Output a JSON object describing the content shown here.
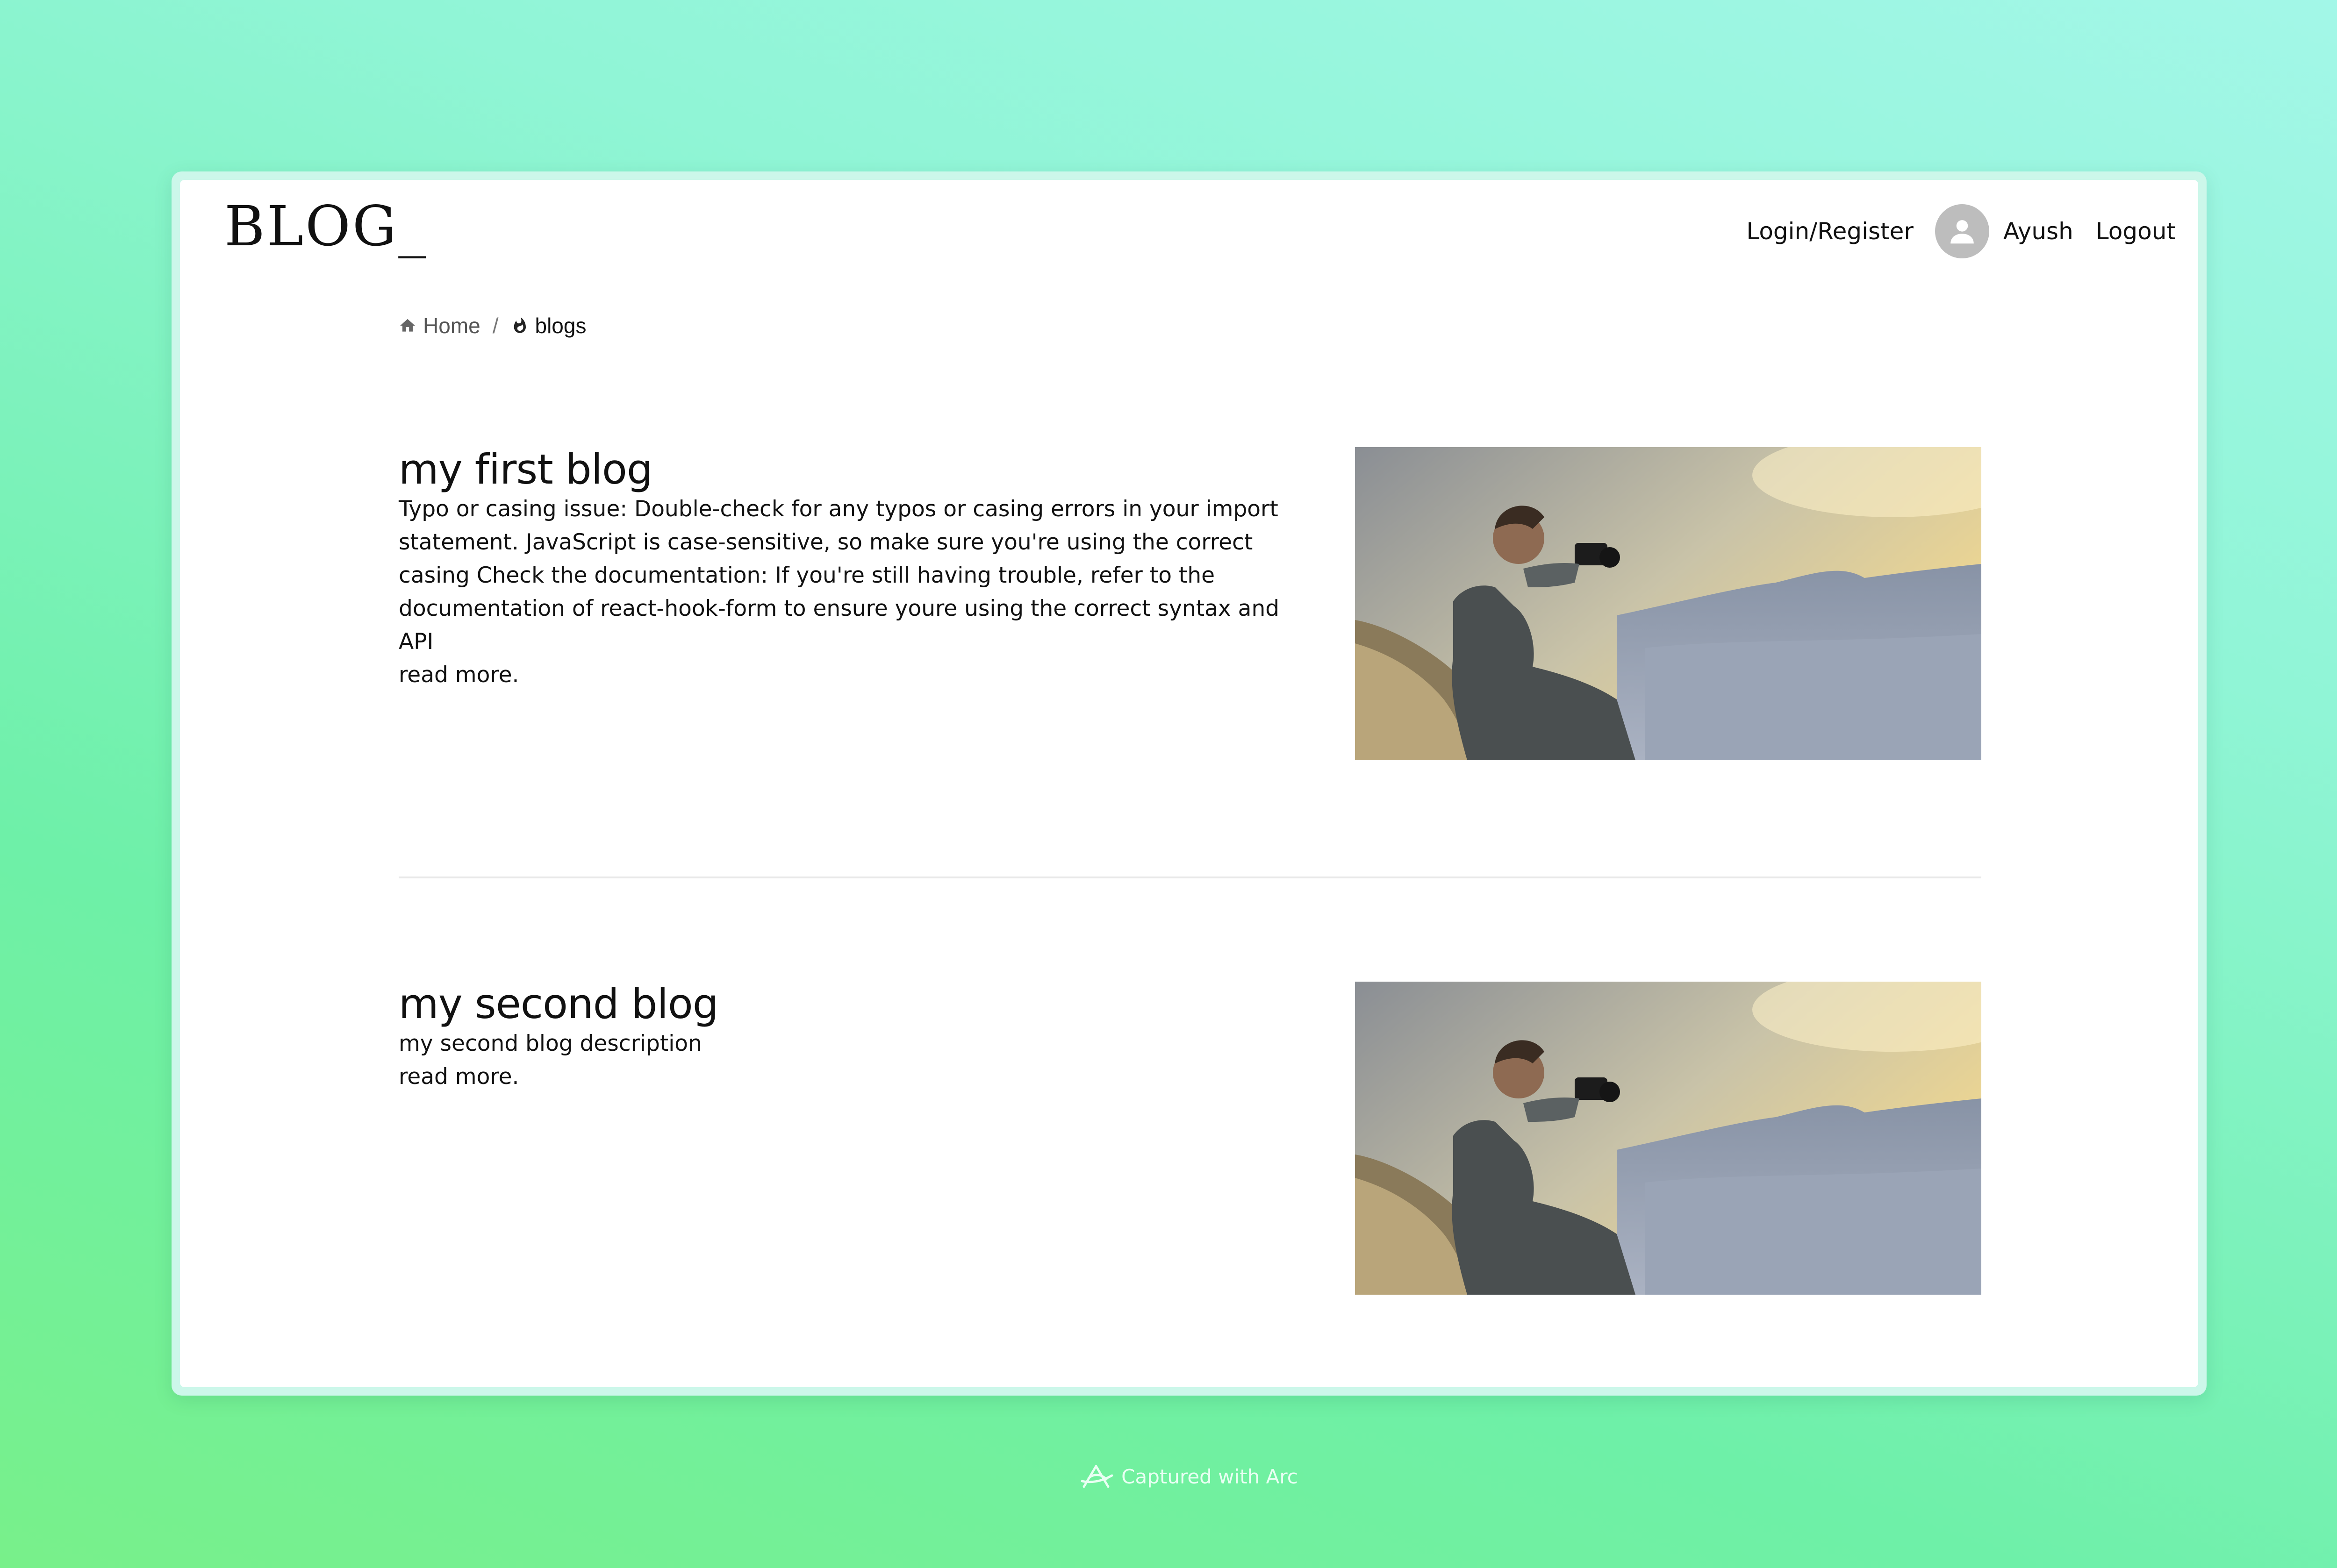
{
  "header": {
    "logo": "BLOG_",
    "login_label": "Login/Register",
    "user_name": "Ayush",
    "logout_label": "Logout",
    "avatar_icon": "user-avatar-icon"
  },
  "breadcrumb": {
    "home_label": "Home",
    "separator": "/",
    "current_label": "blogs",
    "home_icon": "home-icon",
    "current_icon": "flame-icon"
  },
  "posts": [
    {
      "title": "my first blog",
      "description": "Typo or casing issue: Double-check for any typos or casing errors in your import statement. JavaScript is case-sensitive, so make sure you're using the correct casing Check the documentation: If you're still having trouble, refer to the documentation of react-hook-form to ensure youre using the correct syntax and API",
      "read_more": "read more."
    },
    {
      "title": "my second blog",
      "description": "my second blog description",
      "read_more": "read more."
    }
  ],
  "footer": {
    "caption": "Captured with Arc",
    "icon": "arc-logo-icon"
  }
}
